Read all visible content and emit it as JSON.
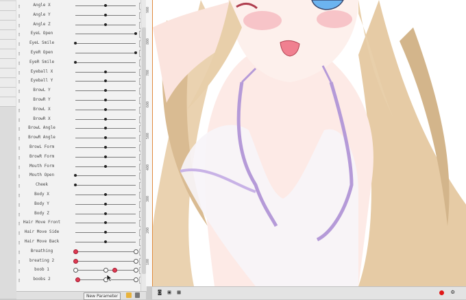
{
  "parameters": [
    {
      "name": "Angle X",
      "value": "0.0",
      "knob": 0.5
    },
    {
      "name": "Angle Y",
      "value": "0.0",
      "knob": 0.5
    },
    {
      "name": "Angle Z",
      "value": "0.0",
      "knob": 0.5
    },
    {
      "name": "EyeL Open",
      "value": "1.0",
      "knob": 1.0
    },
    {
      "name": "EyeL Smile",
      "value": "0.0",
      "knob": 0.0
    },
    {
      "name": "EyeR Open",
      "value": "1.0",
      "knob": 1.0
    },
    {
      "name": "EyeR Smile",
      "value": "0.0",
      "knob": 0.0
    },
    {
      "name": "Eyeball X",
      "value": "0.0",
      "knob": 0.5
    },
    {
      "name": "Eyeball Y",
      "value": "0.0",
      "knob": 0.5
    },
    {
      "name": "BrowL Y",
      "value": "0.0",
      "knob": 0.5
    },
    {
      "name": "BrowR Y",
      "value": "0.0",
      "knob": 0.5
    },
    {
      "name": "BrowL X",
      "value": "0.0",
      "knob": 0.5
    },
    {
      "name": "BrowR X",
      "value": "0.0",
      "knob": 0.5
    },
    {
      "name": "BrowL Angle",
      "value": "0.0",
      "knob": 0.5
    },
    {
      "name": "BrowR Angle",
      "value": "0.0",
      "knob": 0.5
    },
    {
      "name": "BrowL Form",
      "value": "0.0",
      "knob": 0.5
    },
    {
      "name": "BrowR Form",
      "value": "0.0",
      "knob": 0.5
    },
    {
      "name": "Mouth Form",
      "value": "0.0",
      "knob": 0.5
    },
    {
      "name": "Mouth Open",
      "value": "0.0",
      "knob": 0.0
    },
    {
      "name": "Cheek",
      "value": "0.0",
      "knob": 0.0
    },
    {
      "name": "Body X",
      "value": "0.0",
      "knob": 0.5
    },
    {
      "name": "Body Y",
      "value": "0.0",
      "knob": 0.5
    },
    {
      "name": "Body Z",
      "value": "0.0",
      "knob": 0.5
    },
    {
      "name": "Hair Move Front",
      "value": "0.0",
      "knob": 0.5
    },
    {
      "name": "Hair Move Side",
      "value": "0.0",
      "knob": 0.5
    },
    {
      "name": "Hair Move Back",
      "value": "0.0",
      "knob": 0.5
    },
    {
      "name": "Breathing",
      "value": "0.0",
      "knob": 0.0,
      "markers": [
        {
          "pos": 0.0,
          "red": true
        },
        {
          "pos": 1.0,
          "red": false
        }
      ]
    },
    {
      "name": "breating 2",
      "value": "0.0",
      "knob": 0.0,
      "markers": [
        {
          "pos": 0.0,
          "red": true
        },
        {
          "pos": 1.0,
          "red": false
        }
      ]
    },
    {
      "name": "boob 1",
      "value": "0.3",
      "knob": 0.65,
      "markers": [
        {
          "pos": 0.0,
          "red": false
        },
        {
          "pos": 0.5,
          "red": false
        },
        {
          "pos": 0.65,
          "red": true
        },
        {
          "pos": 1.0,
          "red": false
        }
      ]
    },
    {
      "name": "boobs 2",
      "value": "-0.9",
      "knob": 0.03,
      "markers": [
        {
          "pos": 0.03,
          "red": true
        },
        {
          "pos": 0.5,
          "red": false
        },
        {
          "pos": 1.0,
          "red": false
        }
      ]
    }
  ],
  "footer": {
    "new_parameter_label": "New Parameter"
  },
  "ruler": [
    "900",
    "800",
    "700",
    "600",
    "500",
    "400",
    "300",
    "200",
    "100"
  ],
  "colors": {
    "skin": "#fdeae6",
    "hair": "#ead2b0",
    "hair_shadow": "#c9a880",
    "outfit_trim": "#b59ad8",
    "dress": "#f7f4f9",
    "blush": "#f4a7b0",
    "eye": "#6cb4f0"
  }
}
